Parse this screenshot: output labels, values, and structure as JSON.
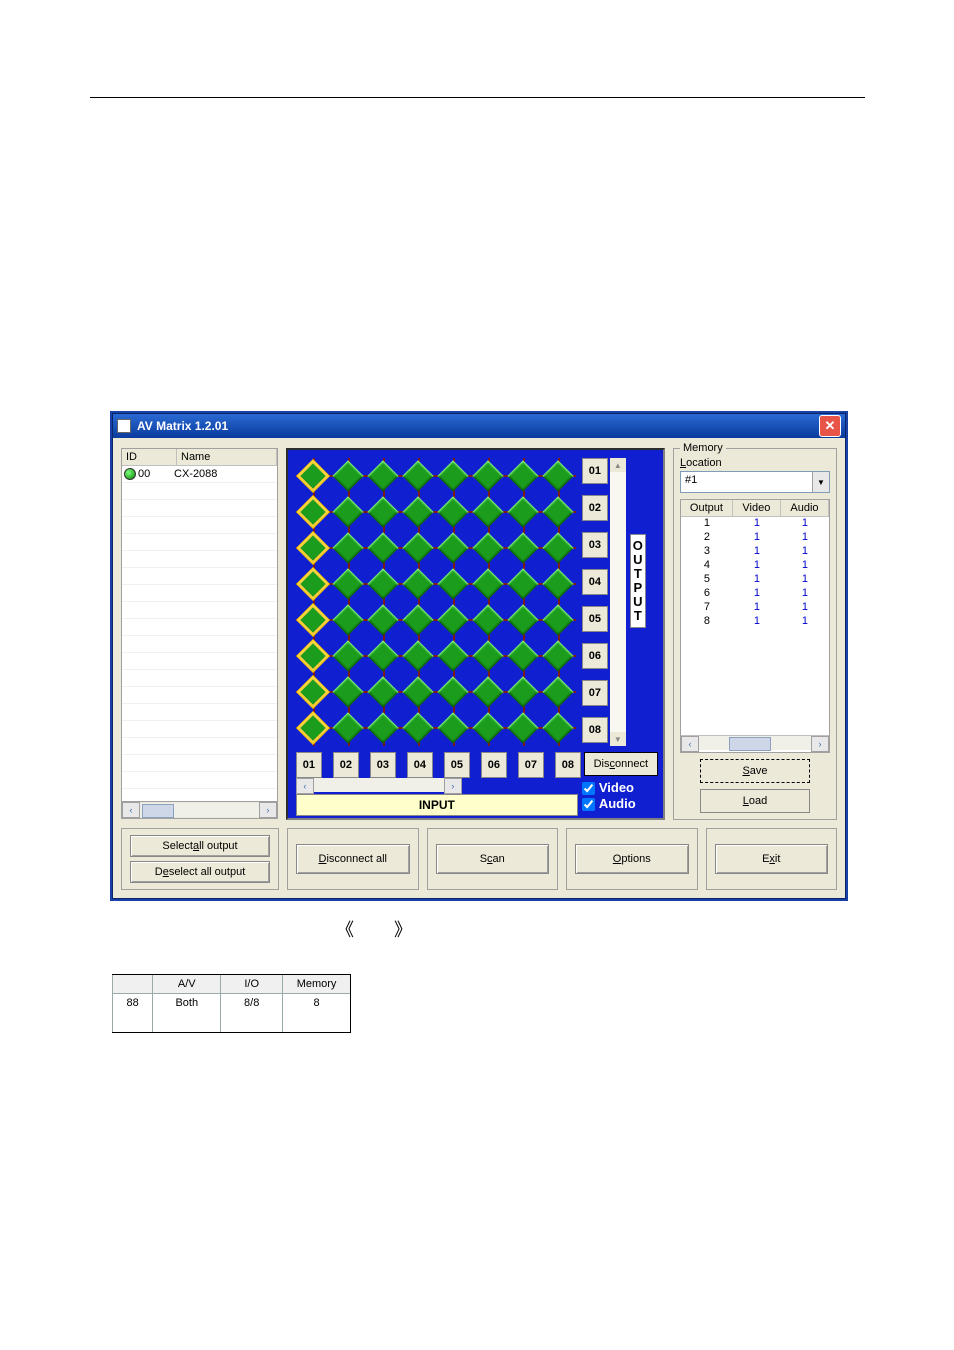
{
  "window": {
    "title": "AV Matrix 1.2.01"
  },
  "device_list": {
    "columns": {
      "id": "ID",
      "name": "Name"
    },
    "rows": [
      {
        "id": "00",
        "name": "CX-2088"
      }
    ]
  },
  "matrix": {
    "outputs": [
      "01",
      "02",
      "03",
      "04",
      "05",
      "06",
      "07",
      "08"
    ],
    "inputs": [
      "01",
      "02",
      "03",
      "04",
      "05",
      "06",
      "07",
      "08"
    ],
    "output_word": "OUTPUT",
    "input_word": "INPUT",
    "disconnect_label": {
      "pre": "Dis",
      "hot": "c",
      "post": "onnect"
    },
    "video_label": "Video",
    "audio_label": "Audio",
    "video_checked": true,
    "audio_checked": true
  },
  "memory": {
    "group_label": "Memory",
    "location_label": {
      "hot": "L",
      "rest": "ocation"
    },
    "location_value": "#1",
    "columns": {
      "out": "Output",
      "vid": "Video",
      "aud": "Audio"
    },
    "rows": [
      {
        "out": "1",
        "vid": "1",
        "aud": "1"
      },
      {
        "out": "2",
        "vid": "1",
        "aud": "1"
      },
      {
        "out": "3",
        "vid": "1",
        "aud": "1"
      },
      {
        "out": "4",
        "vid": "1",
        "aud": "1"
      },
      {
        "out": "5",
        "vid": "1",
        "aud": "1"
      },
      {
        "out": "6",
        "vid": "1",
        "aud": "1"
      },
      {
        "out": "7",
        "vid": "1",
        "aud": "1"
      },
      {
        "out": "8",
        "vid": "1",
        "aud": "1"
      }
    ],
    "save_label": {
      "hot": "S",
      "rest": "ave"
    },
    "load_label": {
      "hot": "L",
      "rest": "oad"
    }
  },
  "buttons": {
    "select_all": {
      "pre": "Select ",
      "hot": "a",
      "post": "ll output"
    },
    "deselect_all": {
      "pre": "D",
      "hot": "e",
      "post": "select all output"
    },
    "disconnect_all": {
      "hot": "D",
      "rest": "isconnect all"
    },
    "scan": {
      "pre": "S",
      "hot": "c",
      "post": "an"
    },
    "options": {
      "hot": "O",
      "rest": "ptions"
    },
    "exit": {
      "pre": "E",
      "hot": "x",
      "post": "it"
    }
  },
  "page_brackets": {
    "left": "《",
    "right": "》"
  },
  "small_table": {
    "head": {
      "c1": "A/V",
      "c2": "I/O",
      "c3": "Memory"
    },
    "row": {
      "c0": "88",
      "c1": "Both",
      "c2": "8/8",
      "c3": "8"
    }
  }
}
